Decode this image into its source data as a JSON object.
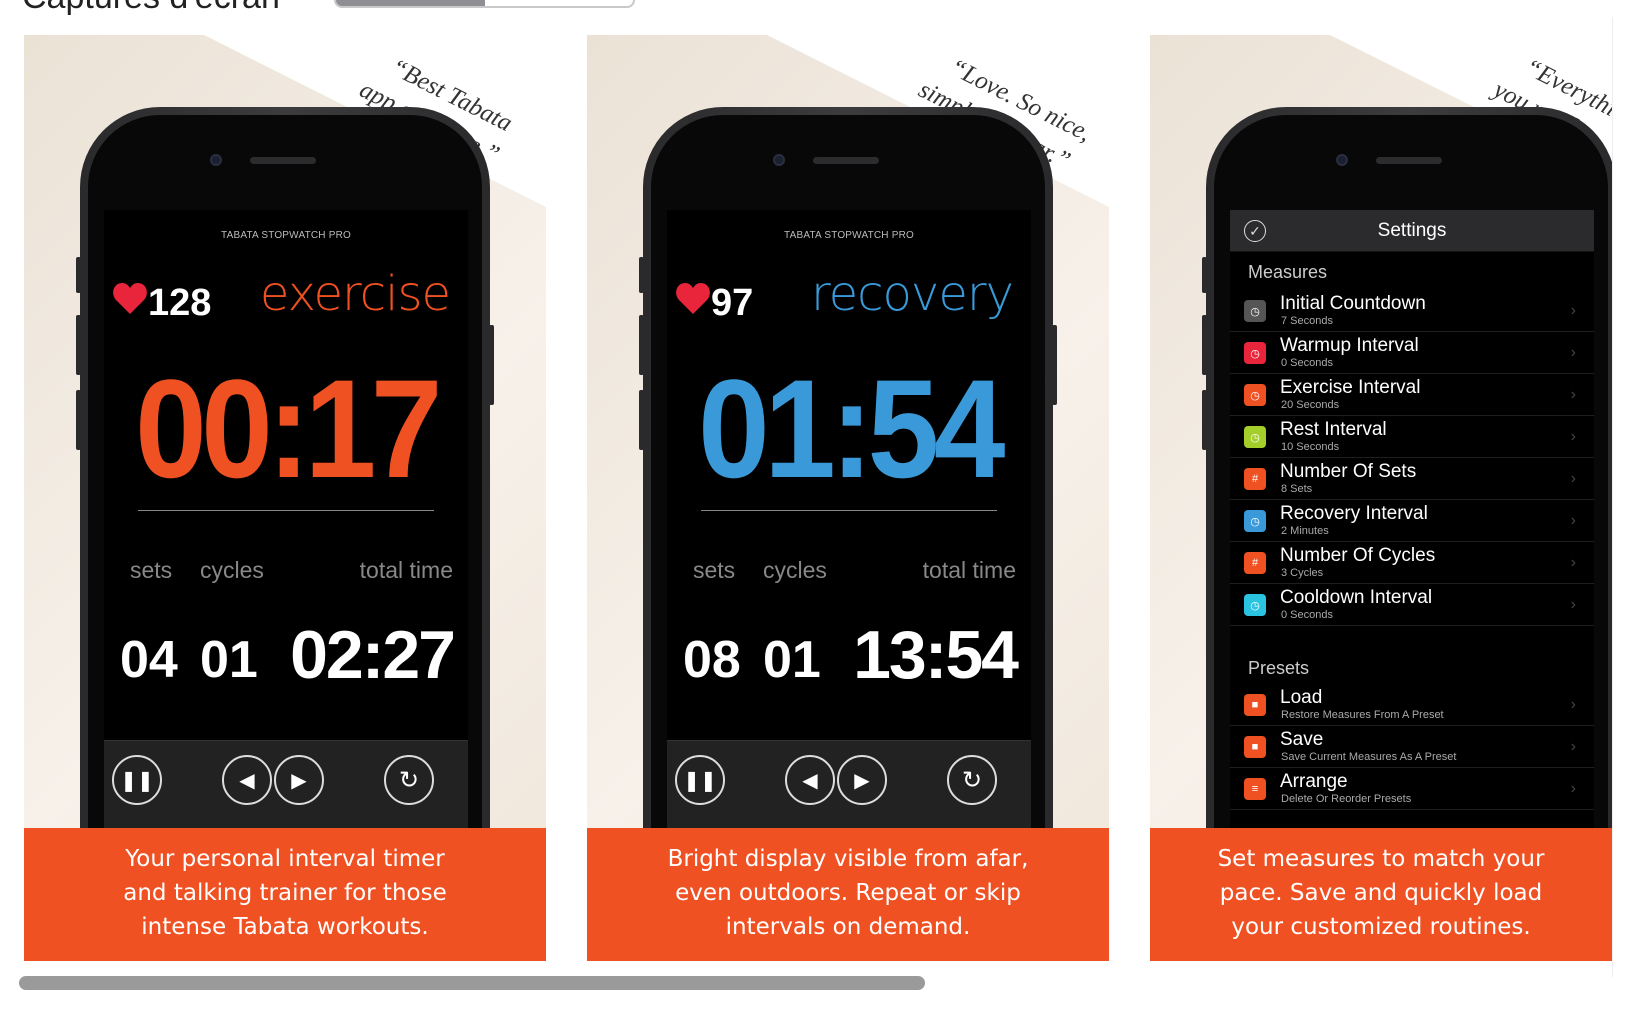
{
  "section": {
    "title": "Captures d'écran"
  },
  "cards": [
    {
      "quote": [
        "“Best Tabata",
        "app out there.”"
      ],
      "app_title": "TABATA STOPWATCH PRO",
      "bpm": "128",
      "phase": "exercise",
      "timer": "00:17",
      "labels": {
        "sets": "sets",
        "cycles": "cycles",
        "total": "total time"
      },
      "values": {
        "sets": "04",
        "cycles": "01",
        "total": "02:27"
      },
      "caption": [
        "Your personal interval timer",
        "and talking trainer for those",
        "intense Tabata workouts."
      ]
    },
    {
      "quote": [
        "“Love. So nice,",
        "simple & clear.”"
      ],
      "app_title": "TABATA STOPWATCH PRO",
      "bpm": "97",
      "phase": "recovery",
      "timer": "01:54",
      "labels": {
        "sets": "sets",
        "cycles": "cycles",
        "total": "total time"
      },
      "values": {
        "sets": "08",
        "cycles": "01",
        "total": "13:54"
      },
      "caption": [
        "Bright display visible from afar,",
        "even outdoors. Repeat or skip",
        "intervals on demand."
      ]
    },
    {
      "quote": [
        "“Everythin",
        "you need."
      ],
      "settings": {
        "title": "Settings",
        "measures_label": "Measures",
        "presets_label": "Presets",
        "measures": [
          {
            "title": "Initial Countdown",
            "sub": "7 Seconds",
            "color": "#555555",
            "glyph": "◷"
          },
          {
            "title": "Warmup Interval",
            "sub": "0 Seconds",
            "color": "#e8253a",
            "glyph": "◷"
          },
          {
            "title": "Exercise Interval",
            "sub": "20 Seconds",
            "color": "#f05123",
            "glyph": "◷"
          },
          {
            "title": "Rest Interval",
            "sub": "10 Seconds",
            "color": "#a4cf2a",
            "glyph": "◷"
          },
          {
            "title": "Number Of Sets",
            "sub": "8 Sets",
            "color": "#f05123",
            "glyph": "#"
          },
          {
            "title": "Recovery Interval",
            "sub": "2 Minutes",
            "color": "#3a9ad9",
            "glyph": "◷"
          },
          {
            "title": "Number Of Cycles",
            "sub": "3 Cycles",
            "color": "#f05123",
            "glyph": "#"
          },
          {
            "title": "Cooldown Interval",
            "sub": "0 Seconds",
            "color": "#2bc4e0",
            "glyph": "◷"
          }
        ],
        "presets": [
          {
            "title": "Load",
            "sub": "Restore Measures From A Preset",
            "color": "#f05123",
            "glyph": "■"
          },
          {
            "title": "Save",
            "sub": "Save Current Measures As A Preset",
            "color": "#f05123",
            "glyph": "■"
          },
          {
            "title": "Arrange",
            "sub": "Delete Or Reorder Presets",
            "color": "#f05123",
            "glyph": "≡"
          }
        ]
      },
      "caption": [
        "Set measures to match your",
        "pace. Save and quickly load",
        "your customized routines."
      ]
    }
  ],
  "colors": {
    "exercise": "#f05123",
    "recovery": "#3a9ad9",
    "banner": "#f05123",
    "heart": "#e8253a"
  },
  "icons": {
    "pause": "pause-icon",
    "previous": "previous-icon",
    "next": "next-icon",
    "reset": "reset-icon",
    "heart": "heart-icon",
    "check": "check-icon",
    "chevron": "chevron-right-icon"
  }
}
